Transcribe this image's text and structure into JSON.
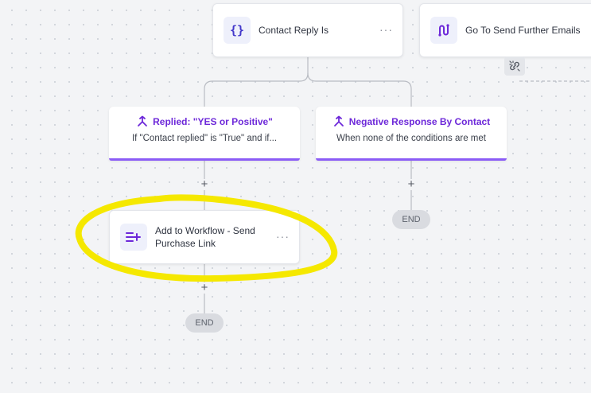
{
  "nodes": {
    "contact_reply": {
      "title": "Contact Reply Is",
      "icon": "curly-braces-icon",
      "menu": "···"
    },
    "go_to": {
      "title": "Go To Send Further Emails",
      "icon": "route-icon"
    },
    "add_workflow": {
      "title": "Add to Workflow - Send Purchase Link",
      "icon": "add-list-icon",
      "menu": "···"
    }
  },
  "branches": {
    "yes": {
      "title": "Replied: \"YES or Positive\"",
      "description": "If \"Contact replied\" is \"True\" and if...",
      "icon": "split-icon"
    },
    "no": {
      "title": "Negative Response By Contact",
      "description": "When none of the conditions are met",
      "icon": "split-icon"
    }
  },
  "controls": {
    "add_symbol": "+",
    "end_label": "END"
  },
  "colors": {
    "accent": "#7c3aed",
    "branch_border": "#8b5cf6",
    "highlight": "#f5e800"
  }
}
